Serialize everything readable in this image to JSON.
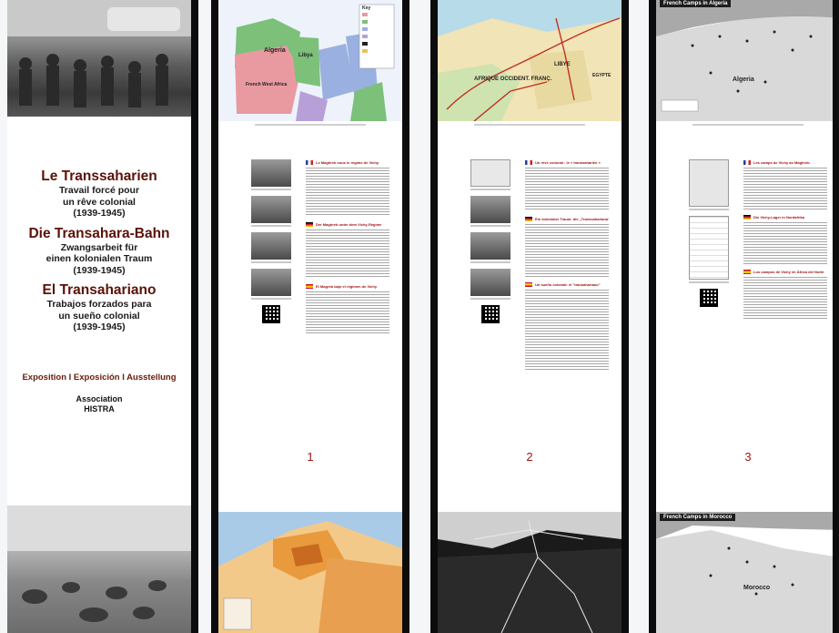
{
  "cover": {
    "fr_title": "Le Transsaharien",
    "fr_sub1": "Travail forcé pour",
    "fr_sub2": "un rêve colonial",
    "fr_years": "(1939-1945)",
    "de_title": "Die Transahara-Bahn",
    "de_sub1": "Zwangsarbeit für",
    "de_sub2": "einen kolonialen Traum",
    "de_years": "(1939-1945)",
    "es_title": "El Transahariano",
    "es_sub1": "Trabajos forzados para",
    "es_sub2": "un sueño colonial",
    "es_years": "(1939-1945)",
    "exposition": "Exposition I Exposición I Ausstellung",
    "association_line1": "Association",
    "association_line2": "HISTRA"
  },
  "panels": [
    {
      "number": "1",
      "map_labels": [
        "Algeria",
        "Libya",
        "French West Africa",
        "Key"
      ],
      "articles": [
        {
          "lang": "fr",
          "title": "Le Maghreb sous le régime de Vichy"
        },
        {
          "lang": "de",
          "title": "Der Maghreb unter dem Vichy-Regime"
        },
        {
          "lang": "es",
          "title": "El Magreb bajo el régimen de Vichy"
        }
      ]
    },
    {
      "number": "2",
      "map_labels": [
        "LIBYE",
        "AFRIQUE OCCIDENT. FRANÇ.",
        "EGYPTE"
      ],
      "articles": [
        {
          "lang": "fr",
          "title": "Un rêve colonial : le « transsaharien »"
        },
        {
          "lang": "de",
          "title": "Ein kolonialer Traum: die „Transsahariana“"
        },
        {
          "lang": "es",
          "title": "Un sueño colonial: el \"transahariano\""
        }
      ]
    },
    {
      "number": "3",
      "map_labels": [
        "French Camps in Algeria",
        "Algeria",
        "French Camps in Morocco",
        "Morocco"
      ],
      "articles": [
        {
          "lang": "fr",
          "title": "Les camps de Vichy au Maghreb"
        },
        {
          "lang": "de",
          "title": "Die Vichy-Lager in Nordafrika"
        },
        {
          "lang": "es",
          "title": "Los campos de Vichy en África del Norte"
        }
      ]
    }
  ],
  "colors": {
    "title_red": "#5a1208",
    "page_number_red": "#a01616",
    "map_pink": "#e89aa0",
    "map_green": "#7cc07a",
    "map_blue": "#9ab0e0",
    "map_orange": "#e89a3c"
  }
}
